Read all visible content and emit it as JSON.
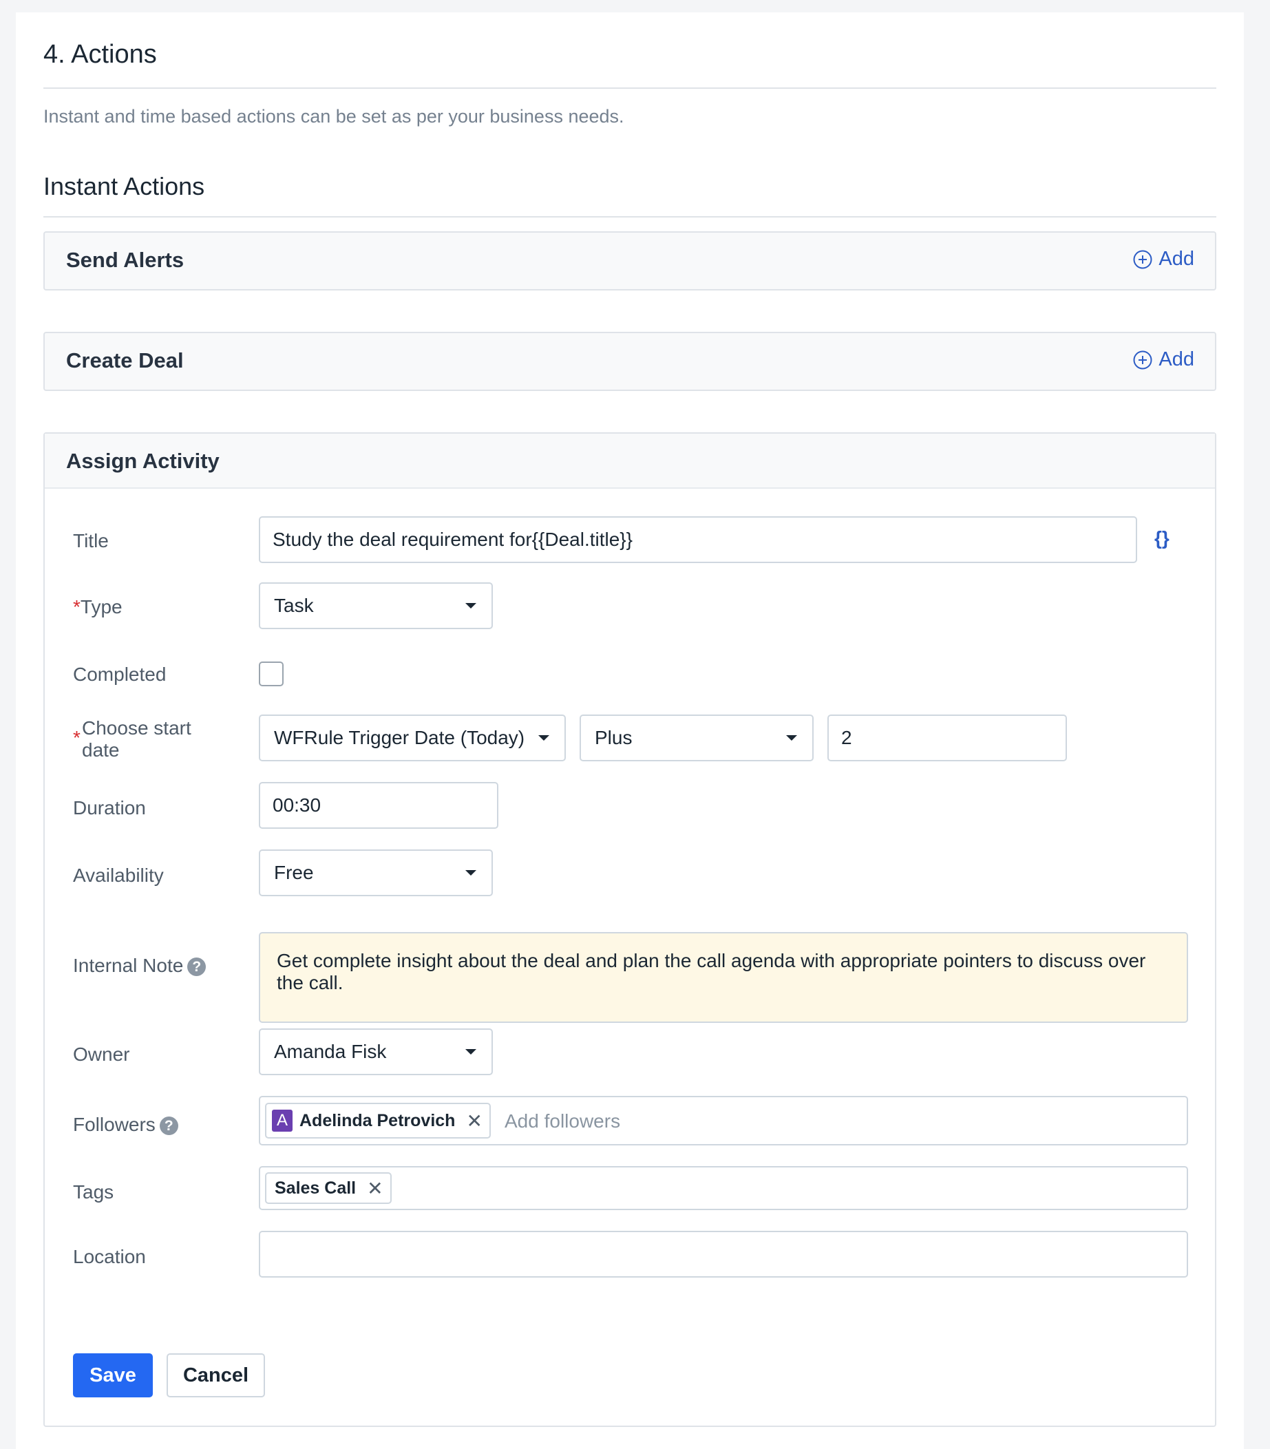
{
  "section": {
    "title": "4. Actions",
    "description": "Instant and time based actions can be set as per your business needs.",
    "subtitle": "Instant Actions"
  },
  "panels": {
    "send_alerts": {
      "title": "Send Alerts",
      "add_label": "Add"
    },
    "create_deal": {
      "title": "Create Deal",
      "add_label": "Add"
    }
  },
  "assign_activity": {
    "title": "Assign Activity",
    "fields": {
      "title": {
        "label": "Title",
        "value": "Study the deal requirement for{{Deal.title}}",
        "placeholder_button": "{}"
      },
      "type": {
        "required_mark": "*",
        "label": "Type",
        "value": "Task"
      },
      "completed": {
        "label": "Completed",
        "checked": false
      },
      "start_date": {
        "required_mark": "*",
        "label_line1": "Choose start",
        "label_line2": "date",
        "date_value": "WFRule Trigger Date (Today)",
        "operator_value": "Plus",
        "offset_value": "2"
      },
      "duration": {
        "label": "Duration",
        "value": "00:30"
      },
      "availability": {
        "label": "Availability",
        "value": "Free"
      },
      "internal_note": {
        "label": "Internal Note",
        "help": "?",
        "value": "Get complete insight about the deal and plan the call agenda with appropriate pointers to discuss over the call."
      },
      "owner": {
        "label": "Owner",
        "value": "Amanda Fisk"
      },
      "followers": {
        "label": "Followers",
        "help": "?",
        "chips": [
          {
            "avatar": "A",
            "name": "Adelinda Petrovich",
            "remove": "✕"
          }
        ],
        "placeholder": "Add followers"
      },
      "tags": {
        "label": "Tags",
        "chips": [
          {
            "name": "Sales Call",
            "remove": "✕"
          }
        ]
      },
      "location": {
        "label": "Location",
        "value": ""
      }
    },
    "buttons": {
      "save": "Save",
      "cancel": "Cancel"
    }
  },
  "colors": {
    "primary": "#2468f2",
    "link": "#2c5cc5",
    "note_bg": "#fef8e5",
    "avatar": "#6a3fb0",
    "required": "#d72d30"
  }
}
